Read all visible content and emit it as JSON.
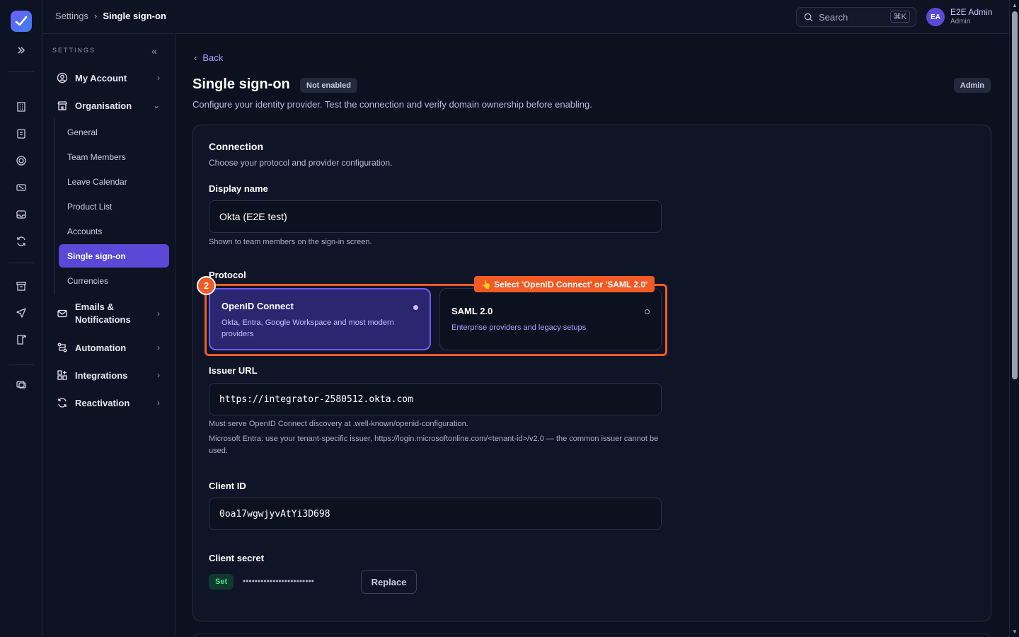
{
  "breadcrumb": {
    "parent": "Settings",
    "separator": "›",
    "current": "Single sign-on"
  },
  "search": {
    "label": "Search",
    "shortcut": "⌘K"
  },
  "user": {
    "initials": "EA",
    "name": "E2E Admin",
    "role": "Admin"
  },
  "sidebar": {
    "header": "SETTINGS",
    "items": [
      {
        "label": "My Account",
        "icon": "user-circle-icon"
      },
      {
        "label": "Organisation",
        "icon": "building-icon"
      },
      {
        "label": "Emails & Notifications",
        "icon": "mail-icon"
      },
      {
        "label": "Automation",
        "icon": "workflow-icon"
      },
      {
        "label": "Integrations",
        "icon": "grid-plus-icon"
      },
      {
        "label": "Reactivation",
        "icon": "refresh-icon"
      }
    ],
    "subitems": [
      "General",
      "Team Members",
      "Leave Calendar",
      "Product List",
      "Accounts",
      "Single sign-on",
      "Currencies"
    ]
  },
  "page": {
    "back": "Back",
    "title": "Single sign-on",
    "status": "Not enabled",
    "role_badge": "Admin",
    "description": "Configure your identity provider. Test the connection and verify domain ownership before enabling."
  },
  "connection": {
    "title": "Connection",
    "subtitle": "Choose your protocol and provider configuration.",
    "display_name_label": "Display name",
    "display_name_value": "Okta (E2E test)",
    "display_name_help": "Shown to team members on the sign-in screen.",
    "protocol_label": "Protocol",
    "protocols": [
      {
        "title": "OpenID Connect",
        "desc": "Okta, Entra, Google Workspace and most modern providers",
        "selected": true
      },
      {
        "title": "SAML 2.0",
        "desc": "Enterprise providers and legacy setups",
        "selected": false
      }
    ],
    "issuer_label": "Issuer URL",
    "issuer_value": "https://integrator-2580512.okta.com",
    "issuer_help_1": "Must serve OpenID Connect discovery at .well-known/openid-configuration.",
    "issuer_help_2": "Microsoft Entra: use your tenant-specific issuer, https://login.microsoftonline.com/<tenant-id>/v2.0 — the common issuer cannot be used.",
    "client_id_label": "Client ID",
    "client_id_value": "0oa17wgwjyvAtYi3D698",
    "client_secret_label": "Client secret",
    "client_secret_status": "Set",
    "client_secret_mask": "••••••••••••••••••••••••",
    "replace_label": "Replace"
  },
  "annotation": {
    "step": "2",
    "tooltip": "👆 Select 'OpenID Connect' or 'SAML 2.0'",
    "color": "#f25a24"
  },
  "colors": {
    "accent": "#5b48d6",
    "background": "#0c1120",
    "highlight": "#f25a24"
  }
}
